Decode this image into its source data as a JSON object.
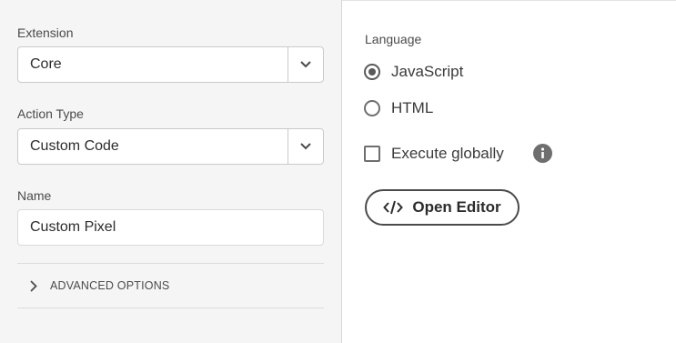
{
  "extension": {
    "label": "Extension",
    "value": "Core"
  },
  "action_type": {
    "label": "Action Type",
    "value": "Custom Code"
  },
  "name_field": {
    "label": "Name",
    "value": "Custom Pixel"
  },
  "advanced_options": {
    "label": "ADVANCED OPTIONS"
  },
  "language": {
    "label": "Language",
    "options": [
      {
        "label": "JavaScript",
        "selected": true
      },
      {
        "label": "HTML",
        "selected": false
      }
    ]
  },
  "execute_globally": {
    "label": "Execute globally",
    "checked": false
  },
  "open_editor": {
    "label": "Open Editor"
  },
  "icons": {
    "dropdown": "chevron-down-icon",
    "expand": "chevron-right-icon",
    "info": "info-icon",
    "code": "code-icon"
  }
}
